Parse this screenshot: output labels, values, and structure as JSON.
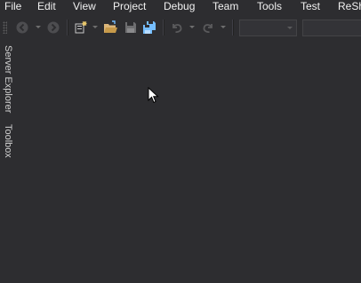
{
  "menu": [
    {
      "label": "File"
    },
    {
      "label": "Edit"
    },
    {
      "label": "View"
    },
    {
      "label": "Project"
    },
    {
      "label": "Debug"
    },
    {
      "label": "Team"
    },
    {
      "label": "Tools"
    },
    {
      "label": "Test"
    },
    {
      "label": "ReSh"
    }
  ],
  "toolbar": {
    "icons": [
      "back-icon",
      "forward-icon",
      "new-project-icon",
      "open-file-icon",
      "save-icon",
      "save-all-icon",
      "undo-icon",
      "redo-icon"
    ],
    "configuration_combo_value": "",
    "platform_combo_value": ""
  },
  "sidebar": {
    "tabs": [
      {
        "label": "Server Explorer"
      },
      {
        "label": "Toolbox"
      }
    ]
  },
  "colors": {
    "background": "#2d2d30",
    "text": "#f1f1f1",
    "folder": "#dcb67a",
    "save_blue": "#75beff"
  }
}
